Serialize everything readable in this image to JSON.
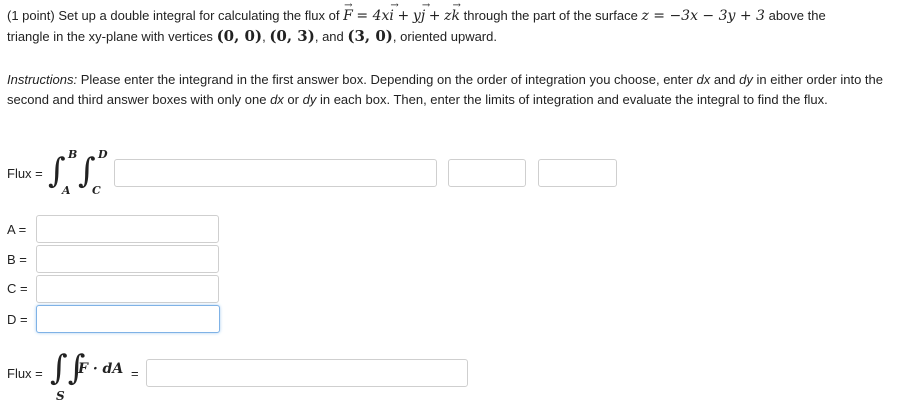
{
  "problem": {
    "points": "(1 point)",
    "text1": "Set up a double integral for calculating the flux of",
    "F": "F",
    "eq": "= 4",
    "x": "x",
    "i": "i",
    "plus1": "+",
    "y": "y",
    "j": "j",
    "plus2": "+",
    "z": "z",
    "k": "k",
    "text2": "through the part of the surface",
    "surface": "z = −3x − 3y + 3",
    "text3": "above the",
    "line2a": "triangle in the xy-plane with vertices",
    "v1": "(0, 0)",
    "v2": "(0, 3)",
    "and": "and",
    "v3": "(3, 0)",
    "line2b": "oriented upward."
  },
  "instructions": {
    "label": "Instructions:",
    "p1": "Please enter the integrand in the first answer box. Depending on the order of integration you choose, enter",
    "dx": "dx",
    "and": "and",
    "dy": "dy",
    "p2": "in either order into the second and third answer boxes with only one",
    "dx2": "dx",
    "or": "or",
    "dy2": "dy",
    "p3": "in each box. Then, enter the limits of integration and evaluate the integral to find the flux."
  },
  "flux_row": {
    "label": "Flux =",
    "upper_outer": "B",
    "lower_outer": "A",
    "upper_inner": "D",
    "lower_inner": "C",
    "integrand_value": "",
    "d1_value": "",
    "d2_value": ""
  },
  "limits": {
    "a_label": "A =",
    "b_label": "B =",
    "c_label": "C =",
    "d_label": "D =",
    "a_value": "",
    "b_value": "",
    "c_value": "",
    "d_value": ""
  },
  "final": {
    "label": "Flux =",
    "integrand": "F · dA",
    "equals": "=",
    "surface_sub": "S",
    "value": ""
  }
}
